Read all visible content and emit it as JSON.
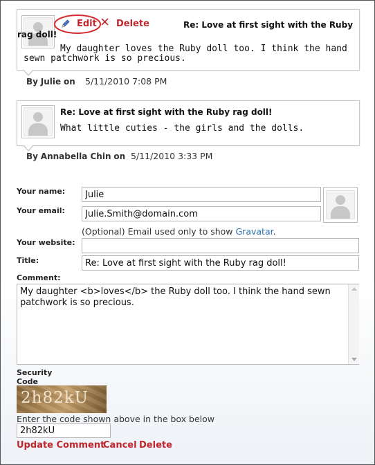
{
  "comments": [
    {
      "title": "Re: Love at first sight with the Ruby rag doll!",
      "body": "My daughter loves the Ruby doll too. I think the hand sewn patchwork is so precious.",
      "by_prefix": "By",
      "author": "Julie",
      "on": "on",
      "date": "5/11/2010 7:08 PM",
      "edit_label": "Edit",
      "delete_label": "Delete"
    },
    {
      "title": "Re: Love at first sight with the Ruby rag doll!",
      "body": "What little cuties - the girls and the dolls.",
      "by_prefix": "By",
      "author": "Annabella Chin",
      "on": "on",
      "date": "5/11/2010 3:33 PM"
    }
  ],
  "form": {
    "name_label": "Your name:",
    "name_value": "Julie",
    "email_label": "Your email:",
    "email_value": "Julie.Smith@domain.com",
    "email_note_prefix": "(Optional) Email used only to show",
    "email_note_link": "Gravatar",
    "email_note_suffix": ".",
    "website_label": "Your website:",
    "website_value": "",
    "title_label": "Title:",
    "title_value": "Re: Love at first sight with the Ruby rag doll!",
    "comment_label": "Comment:",
    "comment_value": "My daughter <b>loves</b> the Ruby doll too. I think the hand sewn patchwork is so precious.",
    "security_label_1": "Security",
    "security_label_2": "Code",
    "captcha_text": "2h82kU",
    "captcha_hint": "Enter the code shown above in the box below",
    "captcha_value": "2h82kU",
    "update_label": "Update Comment",
    "cancel_label": "Cancel",
    "delete_label": "Delete"
  },
  "colors": {
    "accent_red": "#c0272d",
    "link_blue": "#2a6fb0"
  }
}
